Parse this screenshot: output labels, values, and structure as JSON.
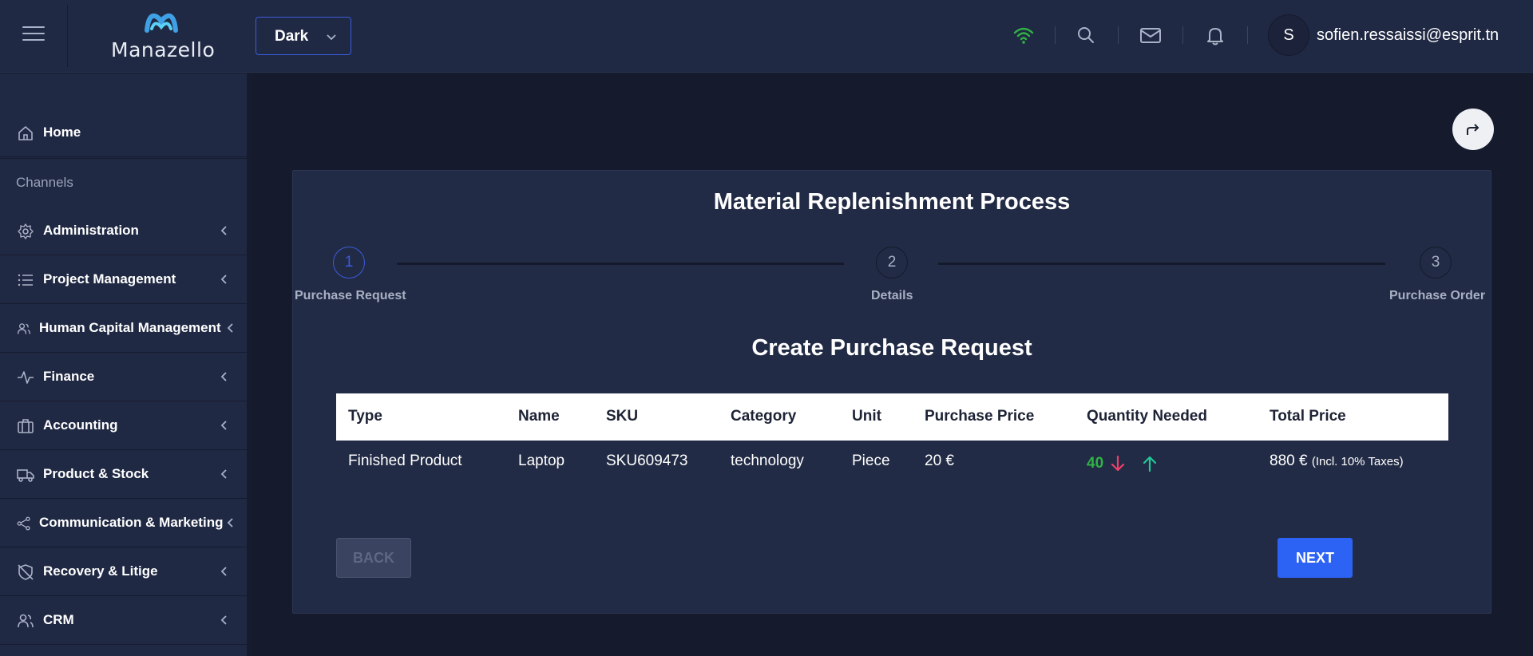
{
  "header": {
    "logo_text": "Manazello",
    "theme_value": "Dark",
    "user_initial": "S",
    "user_email": "sofien.ressaissi@esprit.tn",
    "icons": [
      "menu-icon",
      "wifi-icon",
      "search-icon",
      "mail-icon",
      "bell-icon",
      "chevron-down-icon"
    ],
    "wifi_color": "#2fb344"
  },
  "sidebar": {
    "home": "Home",
    "section": "Channels",
    "items": [
      {
        "label": "Administration",
        "icon": "gear-icon"
      },
      {
        "label": "Project Management",
        "icon": "list-icon"
      },
      {
        "label": "Human Capital Management",
        "icon": "users-icon"
      },
      {
        "label": "Finance",
        "icon": "pulse-icon"
      },
      {
        "label": "Accounting",
        "icon": "briefcase-icon"
      },
      {
        "label": "Product & Stock",
        "icon": "truck-icon"
      },
      {
        "label": "Communication & Marketing",
        "icon": "share-icon"
      },
      {
        "label": "Recovery & Litige",
        "icon": "shield-off-icon"
      },
      {
        "label": "CRM",
        "icon": "users-icon"
      }
    ]
  },
  "main": {
    "title": "Material Replenishment Process",
    "steps": [
      {
        "number": "1",
        "label": "Purchase Request",
        "state": "active"
      },
      {
        "number": "2",
        "label": "Details",
        "state": "inactive"
      },
      {
        "number": "3",
        "label": "Purchase Order",
        "state": "inactive"
      }
    ],
    "section_title": "Create Purchase Request",
    "table": {
      "columns": [
        "Type",
        "Name",
        "SKU",
        "Category",
        "Unit",
        "Purchase Price",
        "Quantity Needed",
        "Total Price"
      ],
      "row": {
        "type": "Finished Product",
        "name": "Laptop",
        "sku": "SKU609473",
        "category": "technology",
        "unit": "Piece",
        "purchase_price": "20 €",
        "quantity": "40",
        "total_price": "880 €",
        "tax_note": "(Incl. 10% Taxes)"
      }
    },
    "back_label": "BACK",
    "next_label": "NEXT",
    "colors": {
      "accent": "#2d63f5",
      "step_active": "#3b5bdb",
      "qty": "#2fb344",
      "decrease": "#f03e6a",
      "increase": "#20c997"
    }
  }
}
